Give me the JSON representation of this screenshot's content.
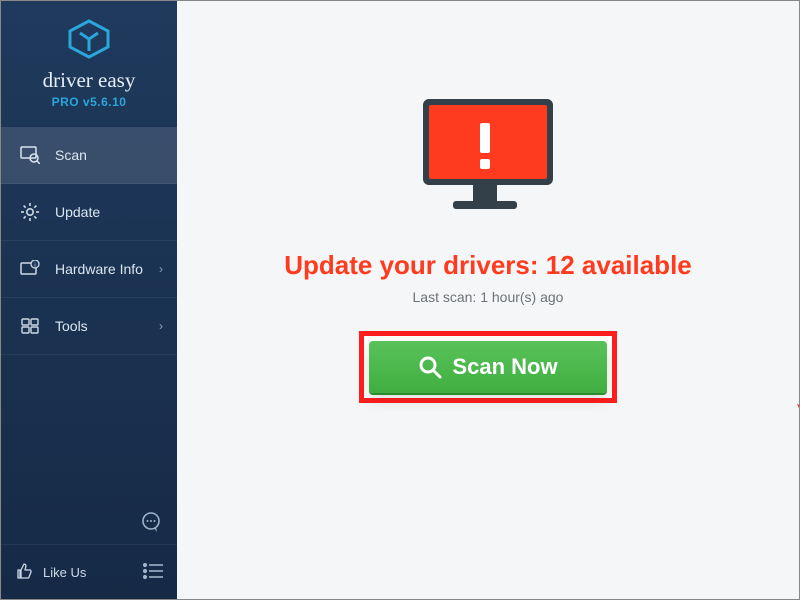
{
  "brand": {
    "name": "driver easy",
    "subtitle": "PRO v5.6.10"
  },
  "sidebar": {
    "items": [
      {
        "label": "Scan"
      },
      {
        "label": "Update"
      },
      {
        "label": "Hardware Info"
      },
      {
        "label": "Tools"
      }
    ],
    "like_label": "Like Us"
  },
  "main": {
    "headline_prefix": "Update your drivers: ",
    "headline_count": "12",
    "headline_suffix": " available",
    "last_scan": "Last scan: 1 hour(s) ago",
    "scan_button": "Scan Now"
  },
  "colors": {
    "accent": "#ff3b1f",
    "scan_green": "#4cb94d",
    "sidebar": "#1f3a5d"
  }
}
